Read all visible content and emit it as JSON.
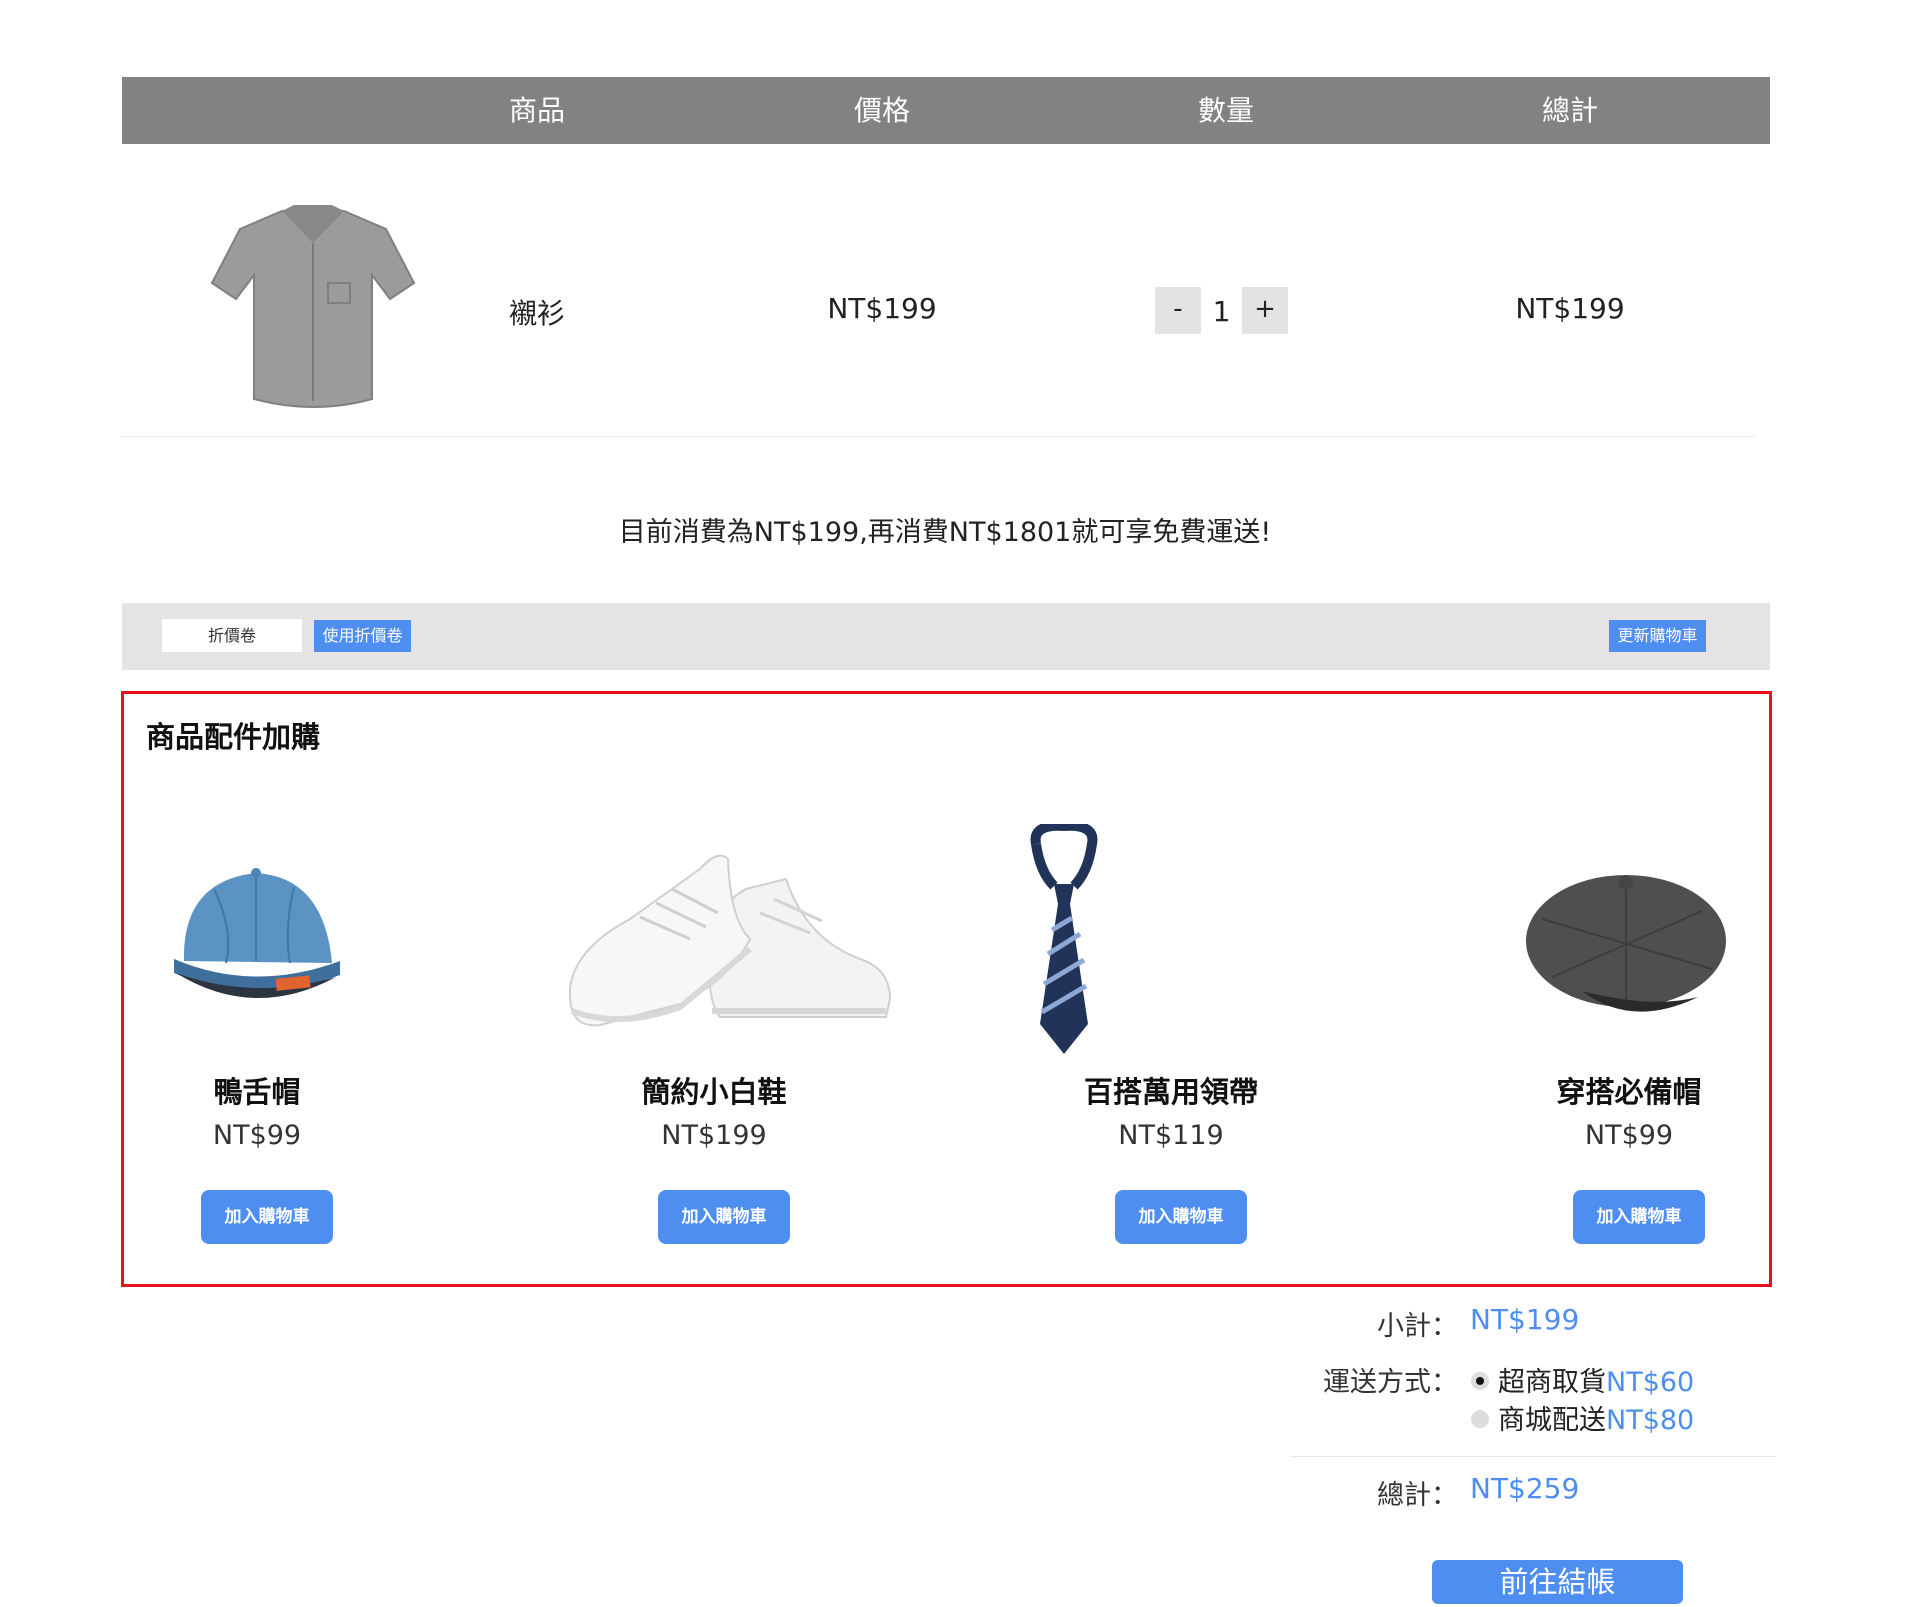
{
  "cart": {
    "headers": {
      "product": "商品",
      "price": "價格",
      "quantity": "數量",
      "total": "總計"
    },
    "item": {
      "name": "襯衫",
      "price": "NT$199",
      "quantity": "1",
      "total": "NT$199"
    },
    "qty_minus": "-",
    "qty_plus": "+"
  },
  "free_shipping_notice": "目前消費為NT$199,再消費NT$1801就可享免費運送!",
  "coupon": {
    "placeholder": "折價卷",
    "apply_label": "使用折價卷",
    "update_label": "更新購物車"
  },
  "addons": {
    "title": "商品配件加購",
    "items": [
      {
        "name": "鴨舌帽",
        "price": "NT$99",
        "button": "加入購物車"
      },
      {
        "name": "簡約小白鞋",
        "price": "NT$199",
        "button": "加入購物車"
      },
      {
        "name": "百搭萬用領帶",
        "price": "NT$119",
        "button": "加入購物車"
      },
      {
        "name": "穿搭必備帽",
        "price": "NT$99",
        "button": "加入購物車"
      }
    ]
  },
  "summary": {
    "subtotal_label": "小計：",
    "subtotal_value": "NT$199",
    "shipping_label": "運送方式：",
    "shipping_options": [
      {
        "label": "超商取貨",
        "price": "NT$60",
        "selected": true
      },
      {
        "label": "商城配送",
        "price": "NT$80",
        "selected": false
      }
    ],
    "total_label": "總計：",
    "total_value": "NT$259",
    "checkout_label": "前往結帳"
  },
  "colors": {
    "accent": "#4d8ef0",
    "header_bg": "#828282",
    "highlight_border": "#e8101b",
    "coupon_bar_bg": "#e5e3e4"
  },
  "icons": [
    "shirt-image",
    "baseball-cap-image",
    "white-sneakers-image",
    "striped-tie-image",
    "newsboy-cap-image"
  ]
}
